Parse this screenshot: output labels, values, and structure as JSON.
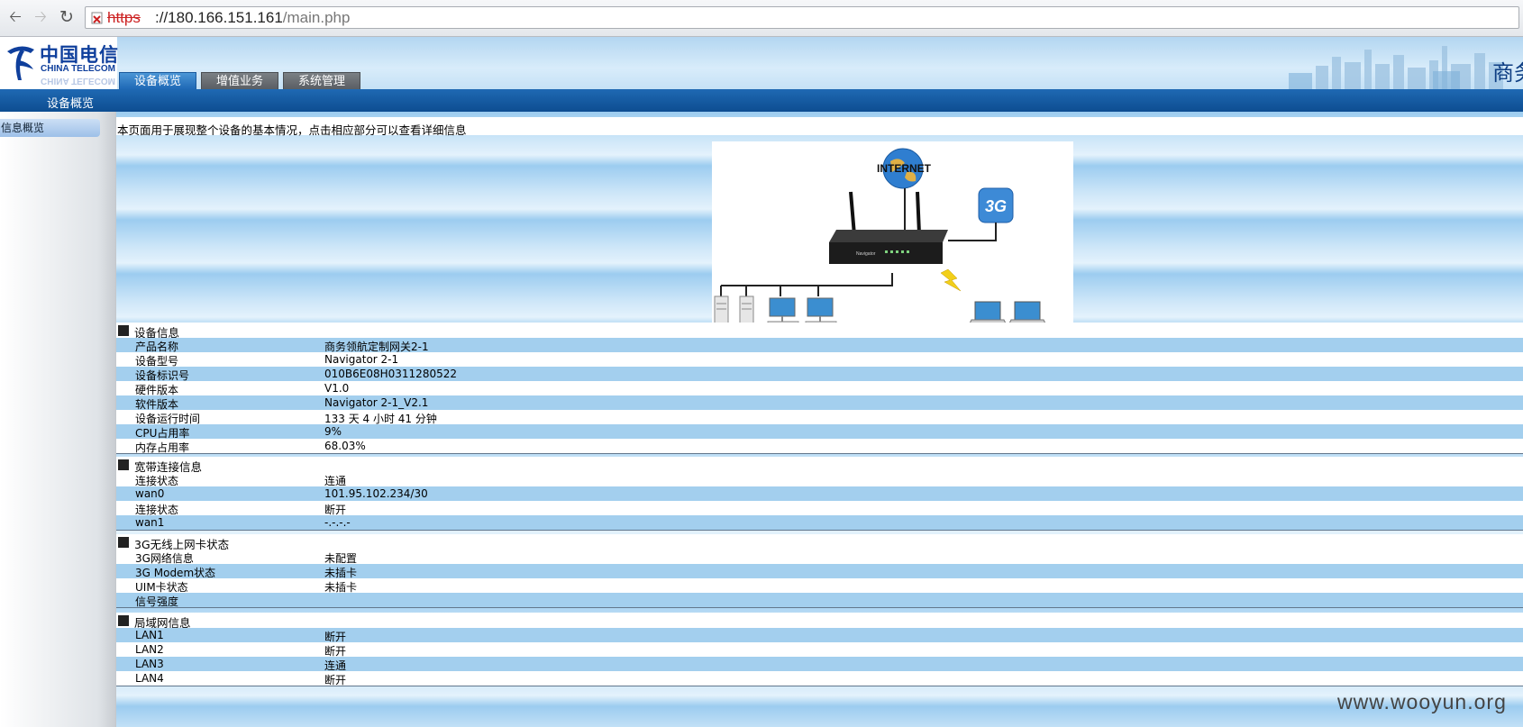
{
  "browser": {
    "url_protocol": "https",
    "url_host": "://180.166.151.161",
    "url_path": "/main.php"
  },
  "header": {
    "logo_cn": "中国电信",
    "logo_en": "CHINA TELECOM",
    "brand_corner": "商务",
    "tabs": [
      {
        "label": "设备概览",
        "active": true
      },
      {
        "label": "增值业务",
        "active": false
      },
      {
        "label": "系统管理",
        "active": false
      }
    ],
    "subnav": "设备概览"
  },
  "sidebar": {
    "items": [
      {
        "label": "信息概览"
      }
    ]
  },
  "intro": "本页面用于展现整个设备的基本情况，点击相应部分可以查看详细信息",
  "diagram": {
    "internet_label": "INTERNET",
    "badge_3g": "3G",
    "device_label": "Navigator"
  },
  "sections": [
    {
      "title": "设备信息",
      "rows": [
        {
          "label": "产品名称",
          "value": "商务领航定制网关2-1"
        },
        {
          "label": "设备型号",
          "value": "Navigator 2-1"
        },
        {
          "label": "设备标识号",
          "value": "010B6E08H0311280522"
        },
        {
          "label": "硬件版本",
          "value": "V1.0"
        },
        {
          "label": "软件版本",
          "value": "Navigator 2-1_V2.1"
        },
        {
          "label": "设备运行时间",
          "value": "133 天 4 小时 41 分钟"
        },
        {
          "label": "CPU占用率",
          "value": "9%"
        },
        {
          "label": "内存占用率",
          "value": "68.03%"
        }
      ]
    },
    {
      "title": "宽带连接信息",
      "rows": [
        {
          "label": "连接状态",
          "value": "连通"
        },
        {
          "label": "wan0",
          "value": "101.95.102.234/30"
        },
        {
          "label": "连接状态",
          "value": "断开"
        },
        {
          "label": "wan1",
          "value": "-.-.-.-"
        }
      ]
    },
    {
      "title": "3G无线上网卡状态",
      "rows": [
        {
          "label": "3G网络信息",
          "value": "未配置"
        },
        {
          "label": "3G Modem状态",
          "value": "未插卡"
        },
        {
          "label": "UIM卡状态",
          "value": "未插卡"
        },
        {
          "label": "信号强度",
          "value": ""
        }
      ]
    },
    {
      "title": "局域网信息",
      "rows": [
        {
          "label": "LAN1",
          "value": "断开"
        },
        {
          "label": "LAN2",
          "value": "断开"
        },
        {
          "label": "LAN3",
          "value": "连通"
        },
        {
          "label": "LAN4",
          "value": "断开"
        }
      ]
    }
  ],
  "watermark": "www.wooyun.org"
}
